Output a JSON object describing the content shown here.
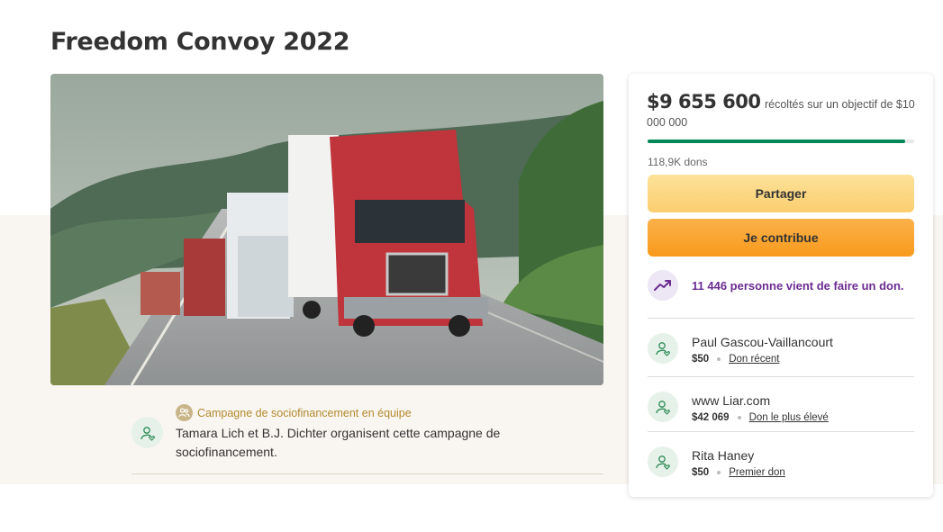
{
  "page": {
    "title": "Freedom Convoy 2022"
  },
  "hero": {
    "icon": "convoy-photo"
  },
  "organizer": {
    "team_label": "Campagne de sociofinancement en équipe",
    "text": "Tamara Lich et B.J. Dichter organisent cette campagne de sociofinancement."
  },
  "donation": {
    "raised_amount": "$9 655 600",
    "raised_text": "récoltés sur un objectif de $10 000 000",
    "progress_fraction": 0.9656,
    "donations_count": "118,9K dons",
    "share_label": "Partager",
    "donate_label": "Je contribue",
    "trend_text": "11 446 personne vient de faire un don."
  },
  "donors": [
    {
      "name": "Paul Gascou-Vaillancourt",
      "amount": "$50",
      "tag": "Don récent"
    },
    {
      "name": "www Liar.com",
      "amount": "$42 069",
      "tag": "Don le plus élevé"
    },
    {
      "name": "Rita Haney",
      "amount": "$50",
      "tag": "Premier don"
    }
  ],
  "colors": {
    "progress": "#028858",
    "share_button": "#fbce6f",
    "donate_button": "#f89a1c",
    "trend_text": "#6b2c91",
    "team_label": "#b38a2f"
  }
}
